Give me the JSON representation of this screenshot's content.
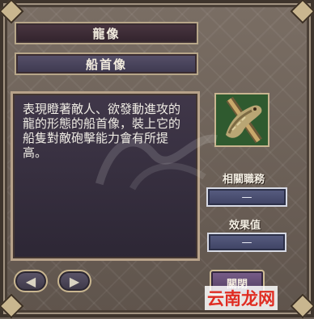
{
  "panel": {
    "title": "龍像",
    "subtitle": "船首像",
    "description": "表現瞪著敵人、欲發動進攻的龍的形態的船首像，裝上它的船隻對敵砲擊能力會有所提高。",
    "portrait_icon": "dragon-figurehead-icon"
  },
  "stats": {
    "job_label": "相關職務",
    "job_value": "—",
    "effect_label": "效果值",
    "effect_value": "—"
  },
  "nav": {
    "prev_symbol": "◀",
    "next_symbol": "▶",
    "close_label": "關閉"
  },
  "watermark": {
    "site": "云南龙网"
  },
  "colors": {
    "title_bar": "#3c2c36",
    "subtitle_bar": "#4a4560",
    "value_box": "#4b5073",
    "accent_border": "#c9b690",
    "watermark_red": "#e02c22"
  }
}
